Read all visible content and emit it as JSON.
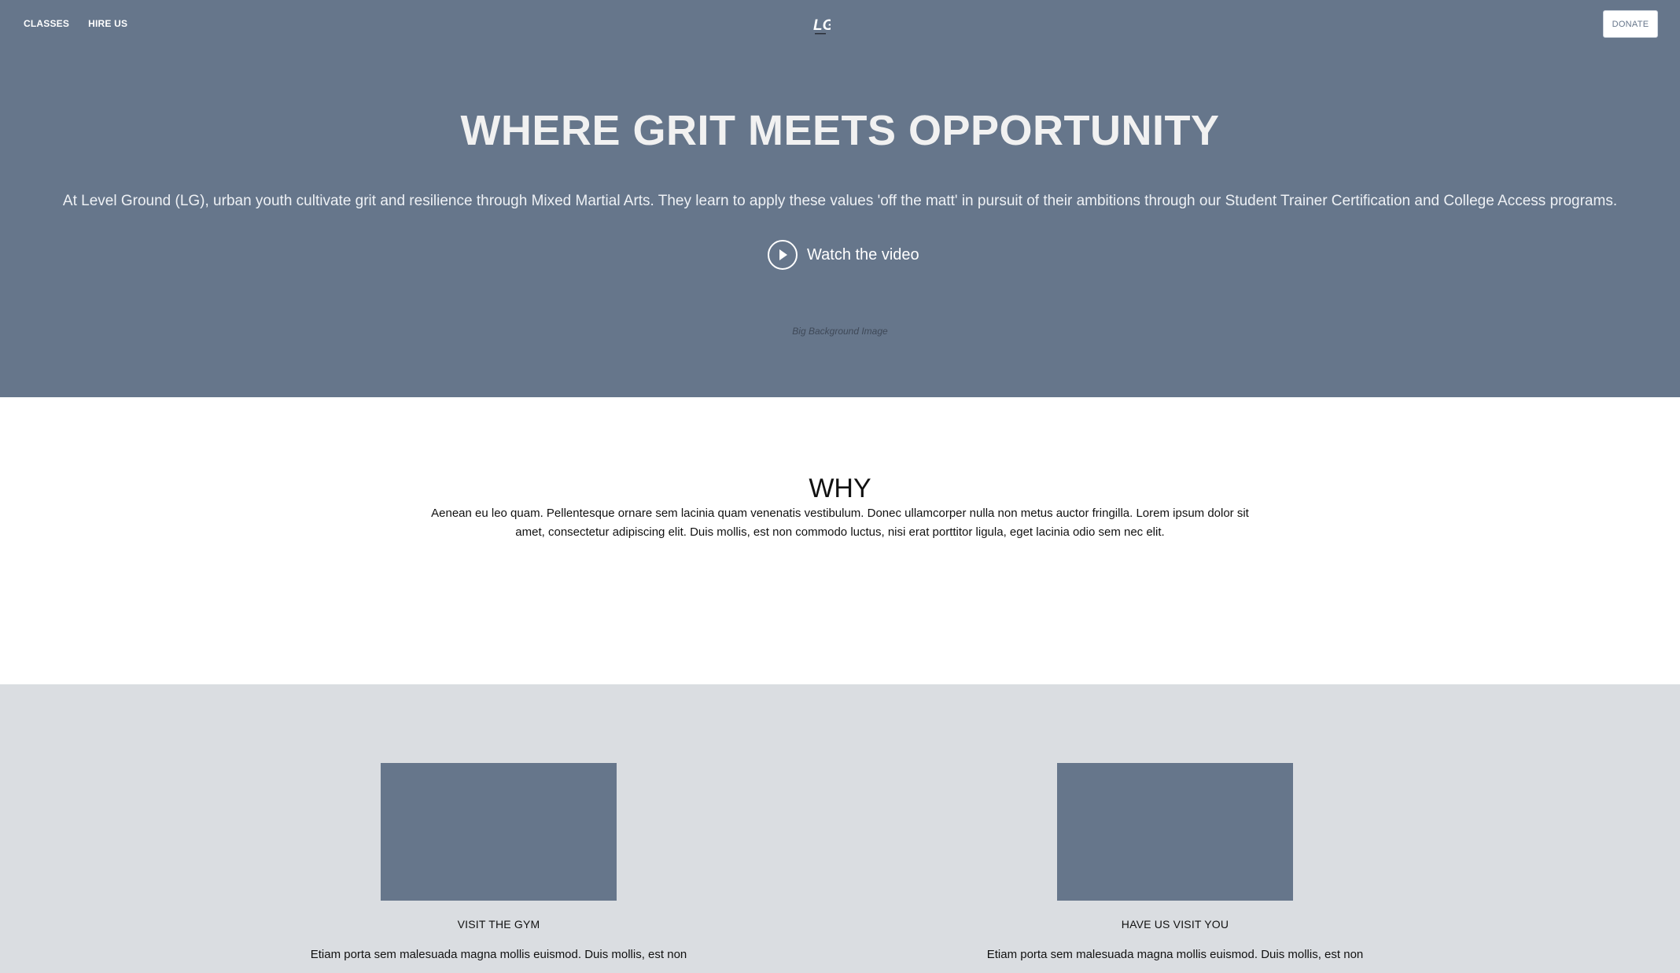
{
  "nav": {
    "links": [
      "CLASSES",
      "HIRE US"
    ],
    "logo": "LG",
    "donate_label": "DONATE"
  },
  "hero": {
    "title": "WHERE GRIT MEETS OPPORTUNITY",
    "subtitle": "At Level Ground (LG), urban youth cultivate grit and resilience through Mixed Martial Arts. They learn to apply these values 'off the matt' in pursuit of their ambitions through our Student Trainer Certification and College Access programs.",
    "watch_label": "Watch the video",
    "background_caption": "Big Background Image"
  },
  "why": {
    "title": "WHY",
    "body": "Aenean eu leo quam. Pellentesque ornare sem lacinia quam venenatis vestibulum. Donec ullamcorper nulla non metus auctor fringilla. Lorem ipsum dolor sit amet, consectetur adipiscing elit. Duis mollis, est non commodo luctus, nisi erat porttitor ligula, eget lacinia odio sem nec elit."
  },
  "cards": [
    {
      "title": "VISIT THE GYM",
      "text": "Etiam porta sem malesuada magna mollis euismod. Duis mollis, est non"
    },
    {
      "title": "HAVE US VISIT YOU",
      "text": "Etiam porta sem malesuada magna mollis euismod. Duis mollis, est non"
    }
  ],
  "colors": {
    "hero_bg": "#66768b",
    "cards_bg": "#dadde1",
    "placeholder": "#66768b"
  }
}
